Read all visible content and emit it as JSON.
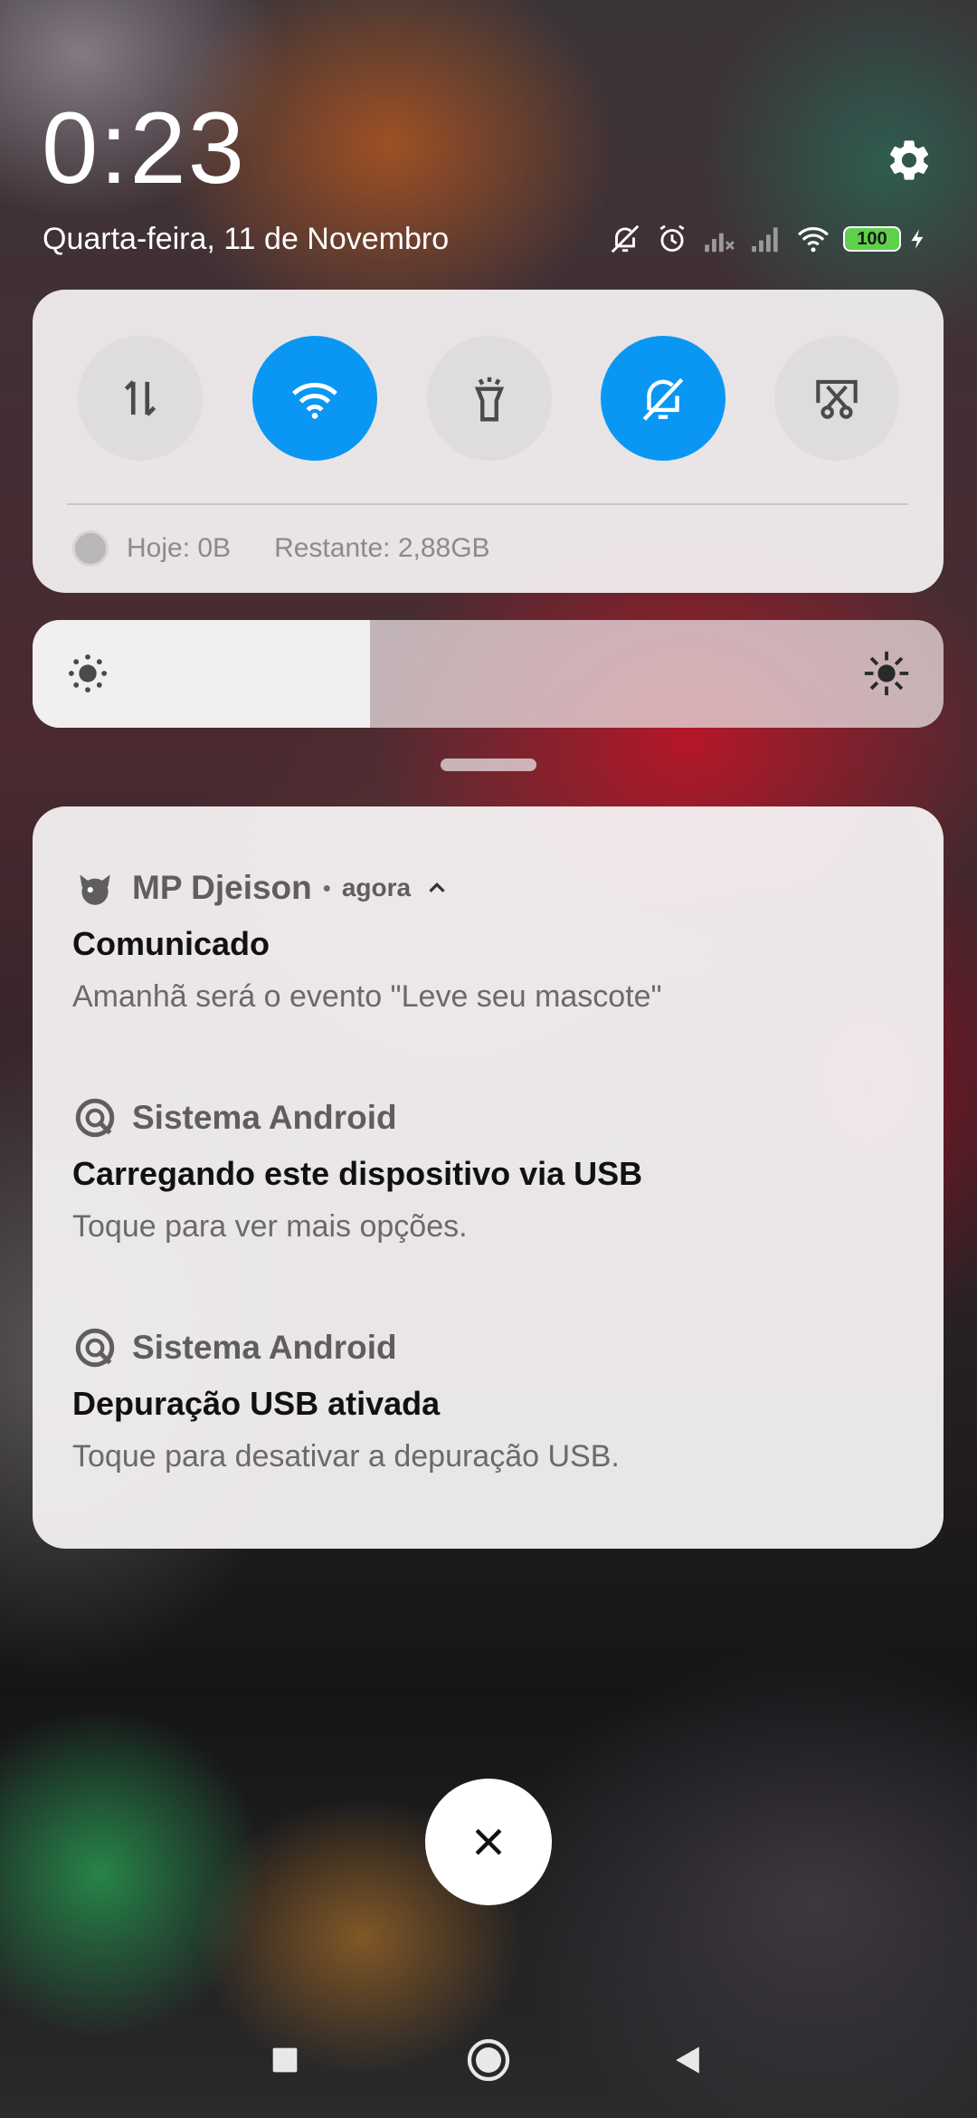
{
  "header": {
    "time": "0:23",
    "date": "Quarta-feira, 11 de Novembro",
    "battery_level": "100"
  },
  "quick_settings": {
    "toggles": [
      {
        "icon": "mobile-data-icon",
        "active": false
      },
      {
        "icon": "wifi-icon",
        "active": true
      },
      {
        "icon": "flashlight-icon",
        "active": false
      },
      {
        "icon": "silent-bell-icon",
        "active": true
      },
      {
        "icon": "screenshot-icon",
        "active": false
      }
    ],
    "data_usage": {
      "today": "Hoje: 0B",
      "remaining": "Restante: 2,88GB"
    },
    "brightness_level": 0.37
  },
  "notifications": [
    {
      "app": "MP Djeison",
      "separator": "•",
      "time": "agora",
      "title": "Comunicado",
      "text": "Amanhã será o evento \"Leve seu mascote\""
    },
    {
      "app": "Sistema Android",
      "title": "Carregando este dispositivo via USB",
      "text": "Toque para ver mais opções."
    },
    {
      "app": "Sistema Android",
      "title": "Depuração USB ativada",
      "text": "Toque para desativar a depuração USB."
    }
  ],
  "colors": {
    "accent": "#0a97f4",
    "battery": "#5fd04b"
  }
}
